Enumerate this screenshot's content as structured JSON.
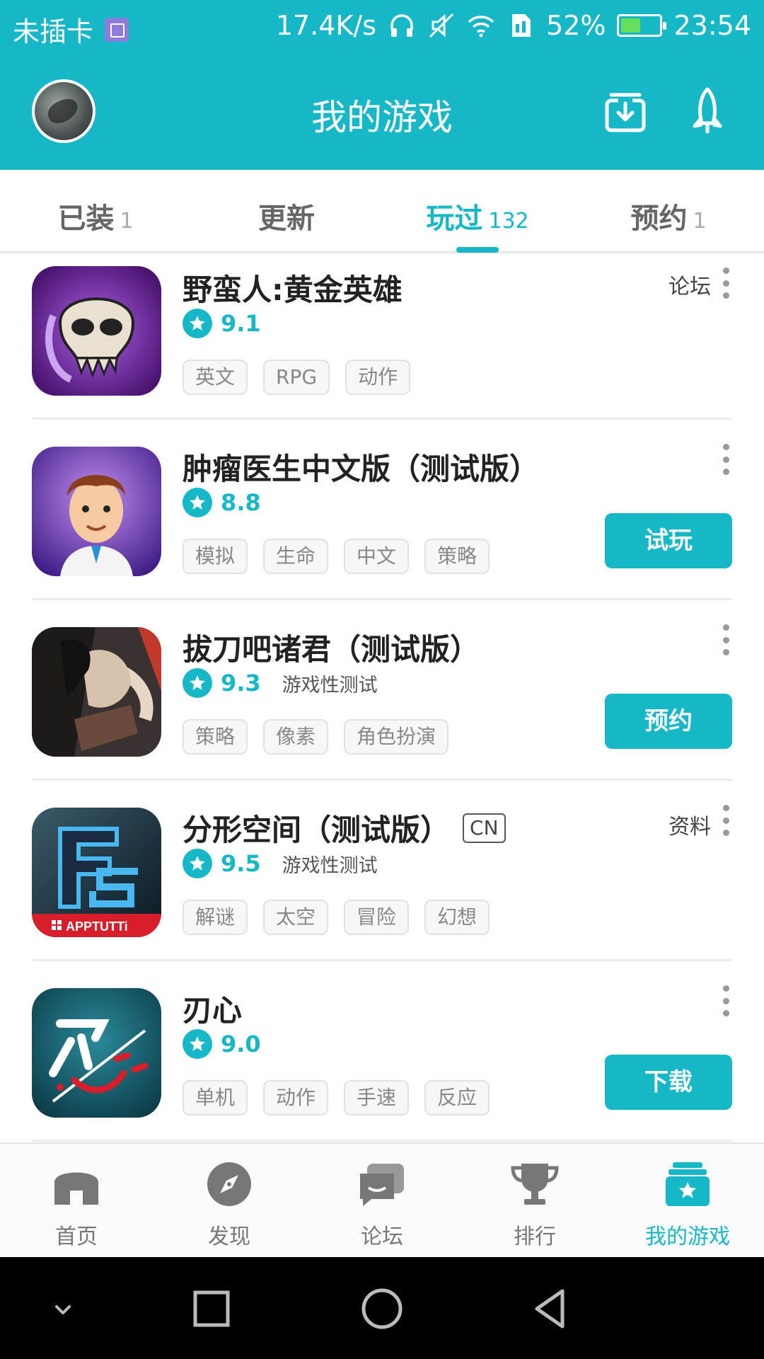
{
  "status_bar": {
    "carrier": "未插卡",
    "speed": "17.4K/s",
    "battery": "52%",
    "battery_level": 0.52,
    "time": "23:54"
  },
  "header": {
    "title": "我的游戏",
    "avatar_icon": "avatar-image",
    "download_icon": "download-icon",
    "rocket_icon": "rocket-icon"
  },
  "tabs": [
    {
      "label": "已装",
      "count": "1",
      "active": false
    },
    {
      "label": "更新",
      "count": "",
      "active": false
    },
    {
      "label": "玩过",
      "count": "132",
      "active": true
    },
    {
      "label": "预约",
      "count": "1",
      "active": false
    }
  ],
  "games": [
    {
      "title": "野蛮人:黄金英雄",
      "badge": "",
      "score": "9.1",
      "note": "",
      "tags": [
        "英文",
        "RPG",
        "动作"
      ],
      "side_link": "论坛",
      "action": ""
    },
    {
      "title": "肿瘤医生中文版（测试版）",
      "badge": "",
      "score": "8.8",
      "note": "",
      "tags": [
        "模拟",
        "生命",
        "中文",
        "策略"
      ],
      "side_link": "",
      "action": "试玩"
    },
    {
      "title": "拔刀吧诸君（测试版）",
      "badge": "",
      "score": "9.3",
      "note": "游戏性测试",
      "tags": [
        "策略",
        "像素",
        "角色扮演"
      ],
      "side_link": "",
      "action": "预约"
    },
    {
      "title": "分形空间（测试版）",
      "badge": "CN",
      "score": "9.5",
      "note": "游戏性测试",
      "tags": [
        "解谜",
        "太空",
        "冒险",
        "幻想"
      ],
      "side_link": "资料",
      "action": "",
      "icon_label": "APPTUTTi"
    },
    {
      "title": "刃心",
      "badge": "",
      "score": "9.0",
      "note": "",
      "tags": [
        "单机",
        "动作",
        "手速",
        "反应"
      ],
      "side_link": "",
      "action": "下载"
    }
  ],
  "bottom_nav": [
    {
      "label": "首页",
      "icon": "home-icon",
      "active": false
    },
    {
      "label": "发现",
      "icon": "compass-icon",
      "active": false
    },
    {
      "label": "论坛",
      "icon": "forum-icon",
      "active": false
    },
    {
      "label": "排行",
      "icon": "trophy-icon",
      "active": false
    },
    {
      "label": "我的游戏",
      "icon": "my-games-icon",
      "active": true
    }
  ],
  "colors": {
    "accent": "#16b8c8",
    "tag_border": "#e2e2e2",
    "text_muted": "#888888"
  }
}
